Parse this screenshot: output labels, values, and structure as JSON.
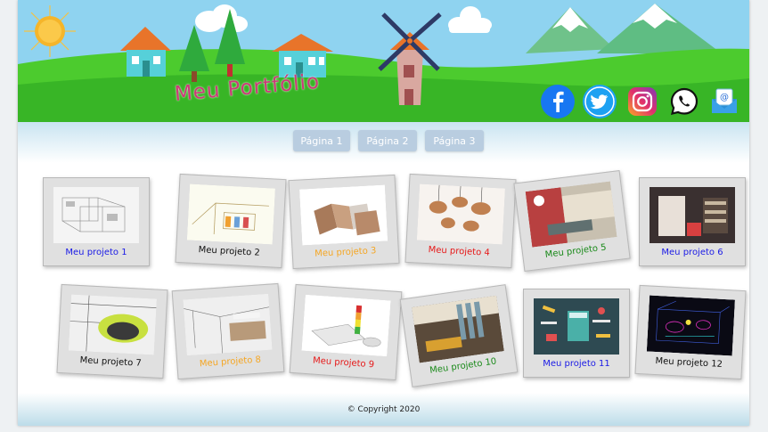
{
  "header": {
    "site_title": "Meu Portfólio",
    "social_icons": [
      "facebook-icon",
      "twitter-icon",
      "instagram-icon",
      "whatsapp-icon",
      "email-icon"
    ]
  },
  "nav": {
    "pages": [
      "Página 1",
      "Página 2",
      "Página 3"
    ]
  },
  "projects": [
    {
      "label": "Meu projeto 1",
      "color": "#1a1ae6"
    },
    {
      "label": "Meu projeto 2",
      "color": "#111111"
    },
    {
      "label": "Meu projeto 3",
      "color": "#f5a623"
    },
    {
      "label": "Meu projeto 4",
      "color": "#e61a1a"
    },
    {
      "label": "Meu projeto 5",
      "color": "#1a8a1a"
    },
    {
      "label": "Meu projeto 6",
      "color": "#1a1ae6"
    },
    {
      "label": "Meu projeto 7",
      "color": "#111111"
    },
    {
      "label": "Meu projeto 8",
      "color": "#f5a623"
    },
    {
      "label": "Meu projeto 9",
      "color": "#e61a1a"
    },
    {
      "label": "Meu projeto 10",
      "color": "#1a8a1a"
    },
    {
      "label": "Meu projeto 11",
      "color": "#1a1ae6"
    },
    {
      "label": "Meu projeto 12",
      "color": "#111111"
    }
  ],
  "footer": {
    "copyright": "© Copyright 2020"
  },
  "colors": {
    "sky": "#8fd3f0",
    "grass": "#3fbf2a",
    "nav_button": "#b9cde0",
    "title": "#cc3a78"
  }
}
